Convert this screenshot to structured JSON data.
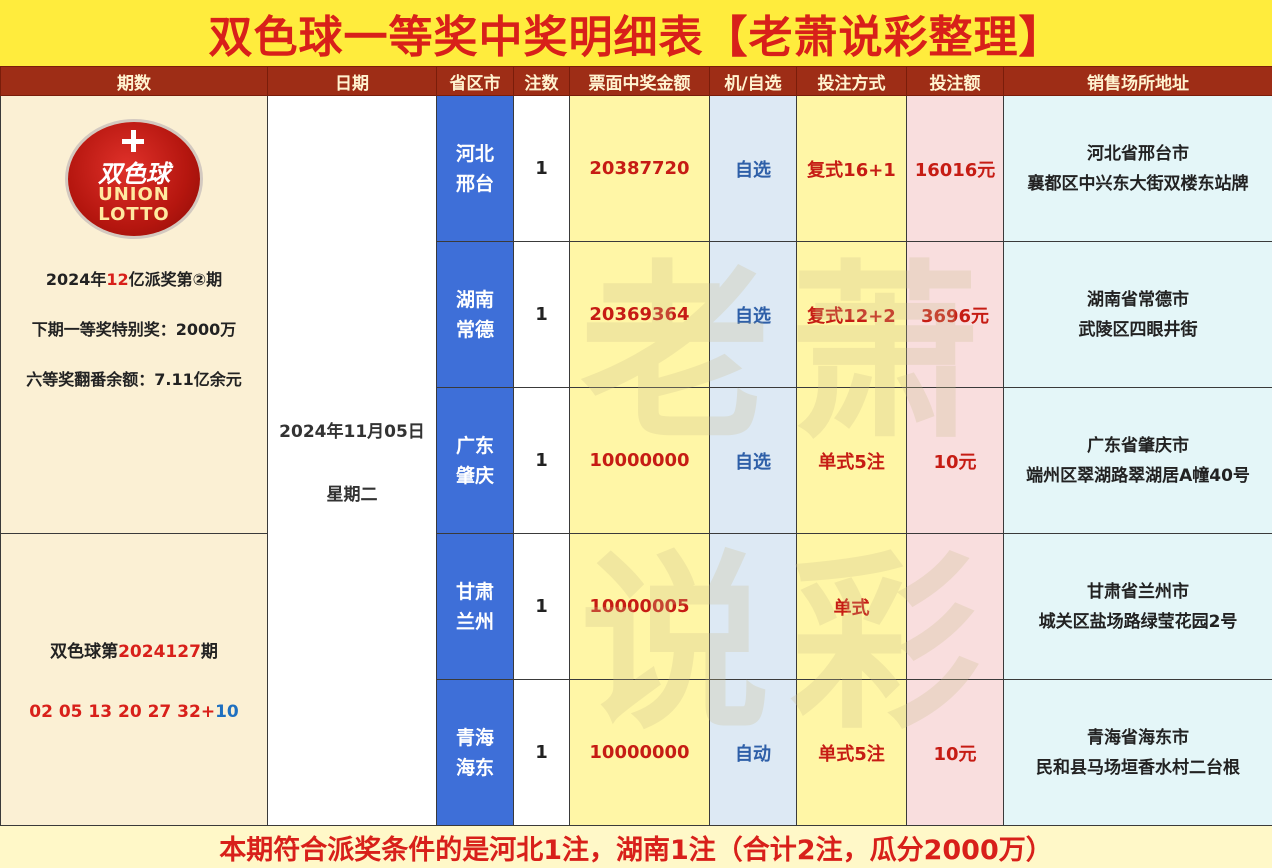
{
  "title": "双色球一等奖中奖明细表【老萧说彩整理】",
  "headers": [
    "期数",
    "日期",
    "省区市",
    "注数",
    "票面中奖金额",
    "机/自选",
    "投注方式",
    "投注额",
    "销售场所地址"
  ],
  "logo": {
    "text_cn": "双色球",
    "text_en_1": "UNION",
    "text_en_2": "LOTTO"
  },
  "issue_info": {
    "line1_prefix": "2024年",
    "line1_highlight": "12",
    "line1_suffix": "亿派奖第②期",
    "line2": "下期一等奖特别奖：2000万",
    "line3": "六等奖翻番余额：7.11亿余元"
  },
  "draw_info": {
    "prefix": "双色球第",
    "number": "2024127",
    "suffix": "期",
    "red_balls": "02 05 13 20 27 32",
    "plus": "+",
    "blue_ball": "10"
  },
  "date": {
    "date": "2024年11月05日",
    "weekday": "星期二"
  },
  "rows": [
    {
      "region_1": "河北",
      "region_2": "邢台",
      "count": "1",
      "amount": "20387720",
      "pick": "自选",
      "method": "复式16+1",
      "bet": "16016元",
      "addr_1": "河北省邢台市",
      "addr_2": "襄都区中兴东大街双楼东站牌"
    },
    {
      "region_1": "湖南",
      "region_2": "常德",
      "count": "1",
      "amount": "20369364",
      "pick": "自选",
      "method": "复式12+2",
      "bet": "3696元",
      "addr_1": "湖南省常德市",
      "addr_2": "武陵区四眼井街"
    },
    {
      "region_1": "广东",
      "region_2": "肇庆",
      "count": "1",
      "amount": "10000000",
      "pick": "自选",
      "method": "单式5注",
      "bet": "10元",
      "addr_1": "广东省肇庆市",
      "addr_2": "端州区翠湖路翠湖居A幢40号"
    },
    {
      "region_1": "甘肃",
      "region_2": "兰州",
      "count": "1",
      "amount": "10000005",
      "pick": "",
      "method": "单式",
      "bet": "",
      "addr_1": "甘肃省兰州市",
      "addr_2": "城关区盐场路绿莹花园2号"
    },
    {
      "region_1": "青海",
      "region_2": "海东",
      "count": "1",
      "amount": "10000000",
      "pick": "自动",
      "method": "单式5注",
      "bet": "10元",
      "addr_1": "青海省海东市",
      "addr_2": "民和县马场垣香水村二台根"
    }
  ],
  "footer": "本期符合派奖条件的是河北1注，湖南1注（合计2注，瓜分2000万）",
  "watermark": [
    "老",
    "萧",
    "说",
    "彩"
  ],
  "colors": {
    "title_bg": "#ffec3d",
    "title_text": "#d8201a",
    "header_bg": "#9e2d16",
    "region_bg": "#3e6fd8"
  }
}
